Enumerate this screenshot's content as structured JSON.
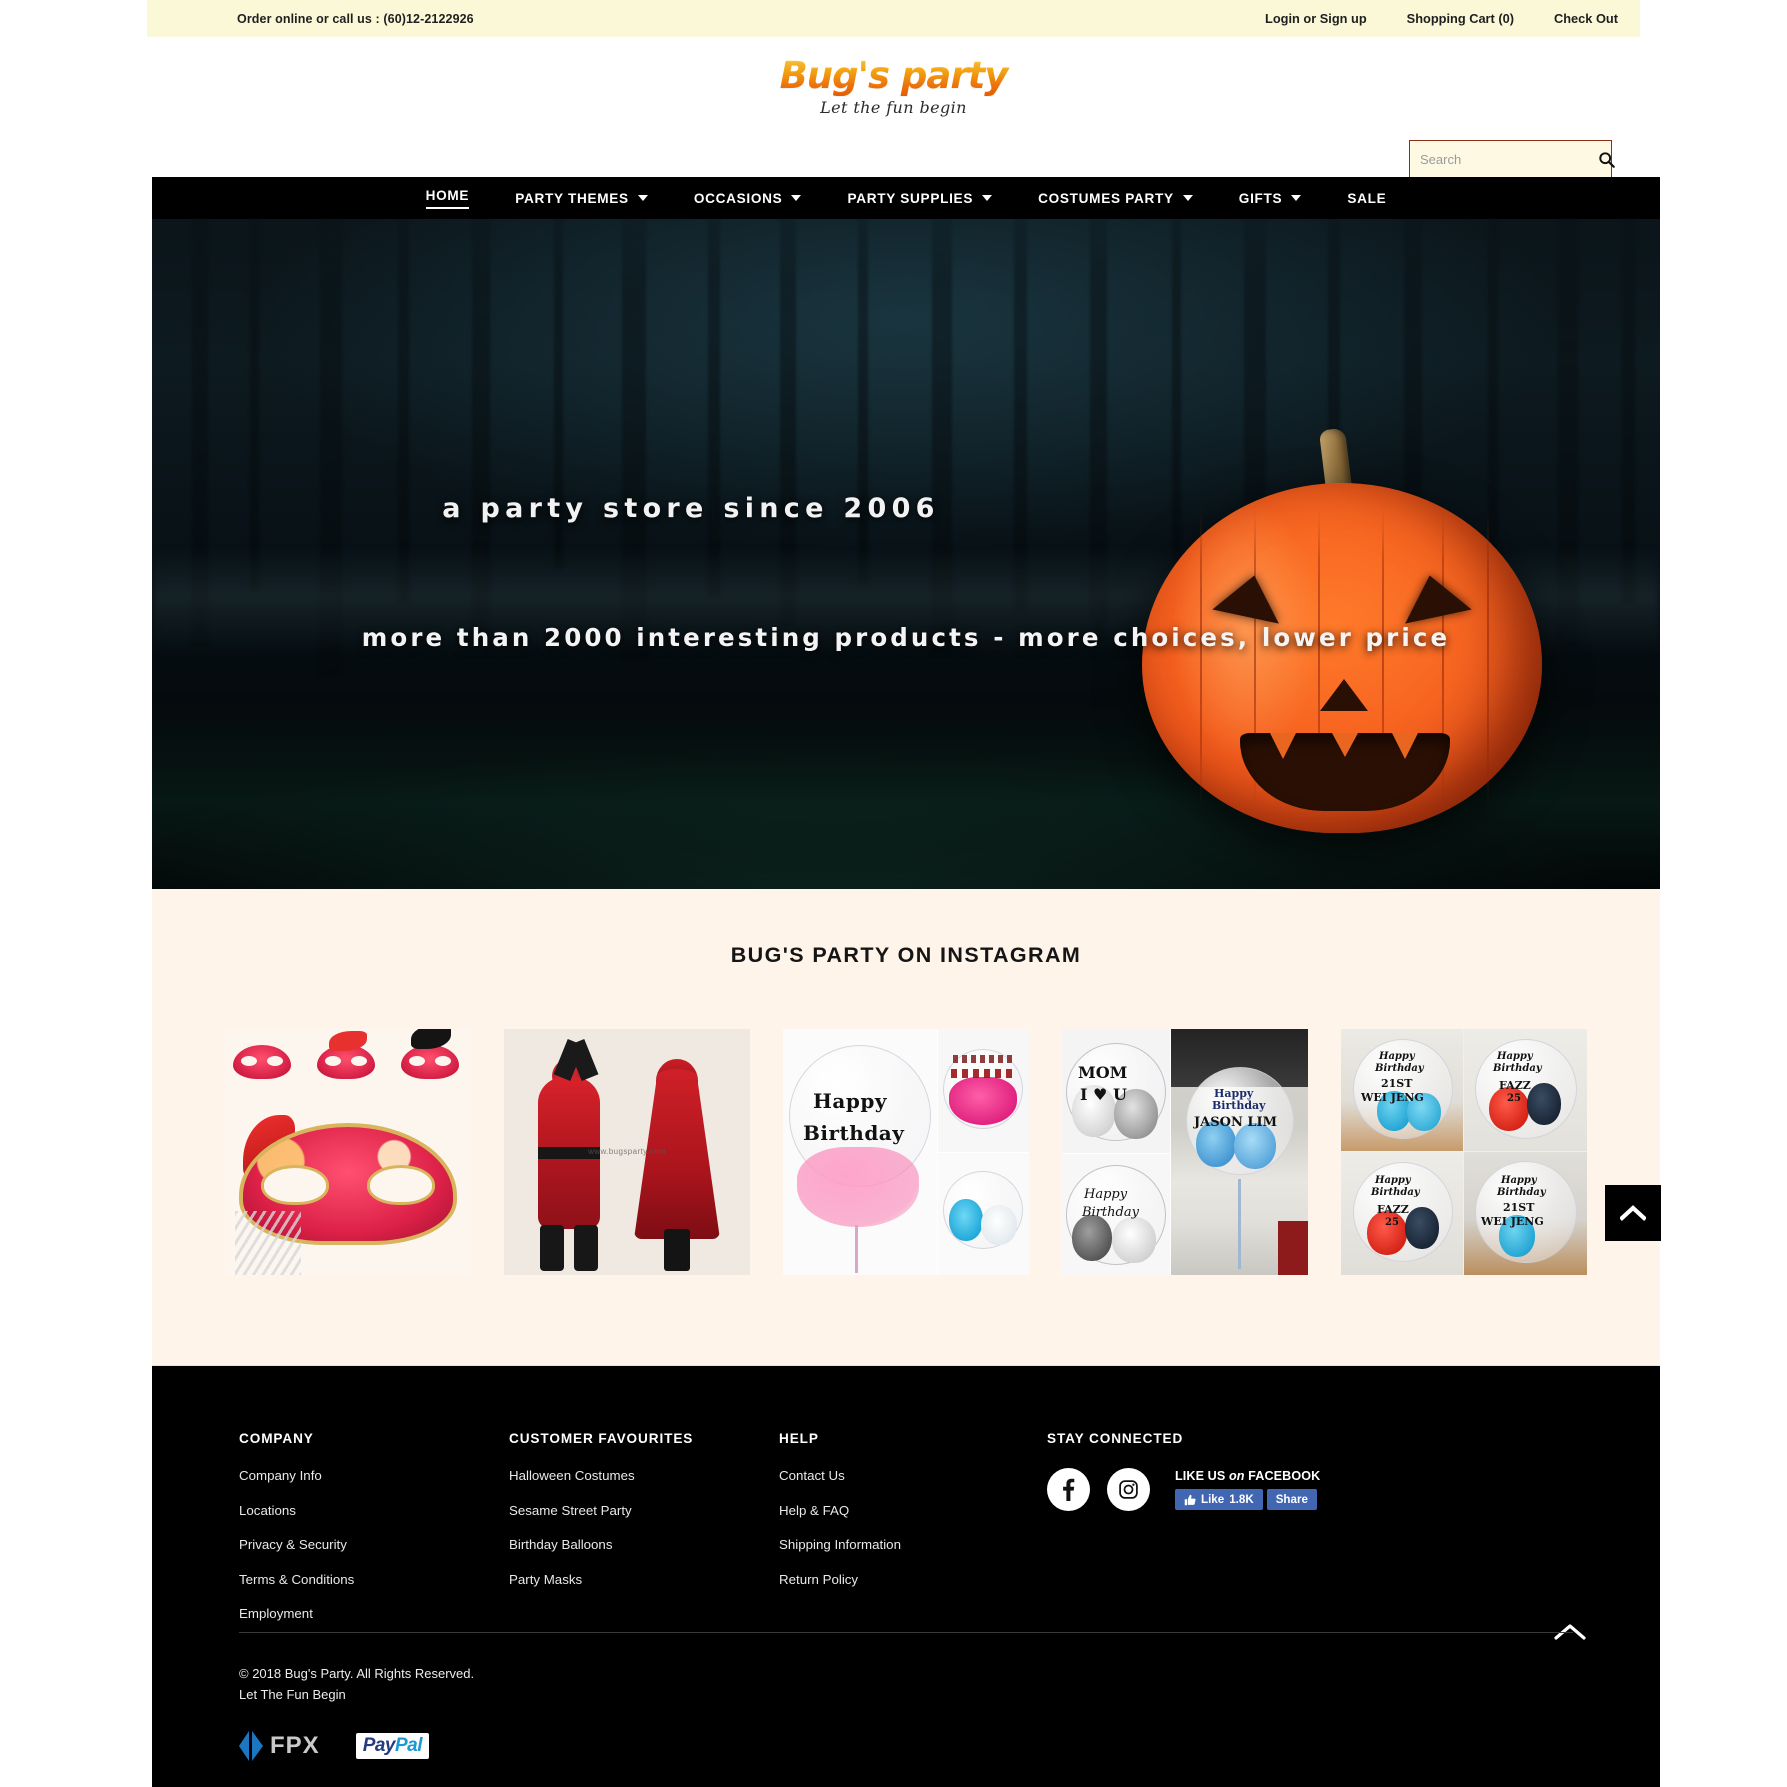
{
  "topbar": {
    "contact": "Order online or call us : (60)12-2122926",
    "links": [
      {
        "label": "Login or Sign up",
        "name": "login-signup-link"
      },
      {
        "label": "Shopping Cart (0)",
        "name": "shopping-cart-link"
      },
      {
        "label": "Check Out",
        "name": "checkout-link"
      }
    ]
  },
  "brand": {
    "logo_text": "Bug's party",
    "tagline": "Let the fun begin",
    "logo_gradient_top": "#ffd24a",
    "logo_gradient_bottom": "#ef6206"
  },
  "search": {
    "placeholder": "Search",
    "value": "",
    "icon": "search-icon",
    "border_color": "#8c2f17",
    "background": "#fdf9e3"
  },
  "nav": {
    "items": [
      {
        "label": "HOME",
        "has_dropdown": false,
        "active": true
      },
      {
        "label": "PARTY THEMES",
        "has_dropdown": true,
        "active": false
      },
      {
        "label": "OCCASIONS",
        "has_dropdown": true,
        "active": false
      },
      {
        "label": "PARTY SUPPLIES",
        "has_dropdown": true,
        "active": false
      },
      {
        "label": "COSTUMES PARTY",
        "has_dropdown": true,
        "active": false
      },
      {
        "label": "GIFTS",
        "has_dropdown": true,
        "active": false
      },
      {
        "label": "SALE",
        "has_dropdown": false,
        "active": false
      }
    ]
  },
  "hero": {
    "line1": "a party store since 2006",
    "line2": "more than 2000 interesting products - more choices, lower price",
    "scene": "halloween-pumpkin-in-dark-forest"
  },
  "instagram": {
    "title": "BUG'S PARTY ON INSTAGRAM",
    "background": "#fef4ea",
    "posts": [
      {
        "alt": "red-venetian-party-masks",
        "name": "instagram-post-1"
      },
      {
        "alt": "deadpool-costume-and-red-hooded-cape",
        "watermark": "www.bugsparty.com",
        "name": "instagram-post-2"
      },
      {
        "alt": "happy-birthday-bubble-balloons",
        "caption": "Happy Birthday",
        "name": "instagram-post-3"
      },
      {
        "alt": "mom-i-love-you-and-jason-lim-balloons",
        "caption": "MOM I ♥ U",
        "caption2": "Happy Birthday JASON LIM",
        "name": "instagram-post-4"
      },
      {
        "alt": "happy-birthday-21st-wei-jeng-and-fa-zz-25-balloons",
        "caption": "Happy Birthday 21ST WEI JENG",
        "caption2": "Happy Birthday FAZZ 25",
        "name": "instagram-post-5"
      }
    ]
  },
  "footer": {
    "columns": [
      {
        "heading": "COMPANY",
        "links": [
          "Company Info",
          "Locations",
          "Privacy & Security",
          "Terms & Conditions",
          "Employment"
        ]
      },
      {
        "heading": "CUSTOMER FAVOURITES",
        "links": [
          "Halloween Costumes",
          "Sesame Street Party",
          "Birthday Balloons",
          "Party Masks"
        ]
      },
      {
        "heading": "HELP",
        "links": [
          "Contact Us",
          "Help & FAQ",
          "Shipping Information",
          "Return Policy"
        ]
      }
    ],
    "social": {
      "heading": "STAY CONNECTED",
      "facebook_icon": "facebook-icon",
      "instagram_icon": "instagram-icon",
      "fb_caption_1": "LIKE US ",
      "fb_caption_em": "on",
      "fb_caption_2": " FACEBOOK",
      "like_label": "Like",
      "like_count": "1.8K",
      "share_label": "Share",
      "fb_blue": "#4267b2"
    },
    "copyright_line1": "© 2018 Bug's Party. All Rights Reserved.",
    "copyright_line2": "Let The Fun Begin",
    "payments": [
      {
        "label": "FPX",
        "name": "fpx-logo"
      },
      {
        "label_1": "Pay",
        "label_2": "Pal",
        "name": "paypal-logo"
      }
    ]
  },
  "scroll_top": {
    "icon": "chevron-up-icon",
    "label": ""
  }
}
